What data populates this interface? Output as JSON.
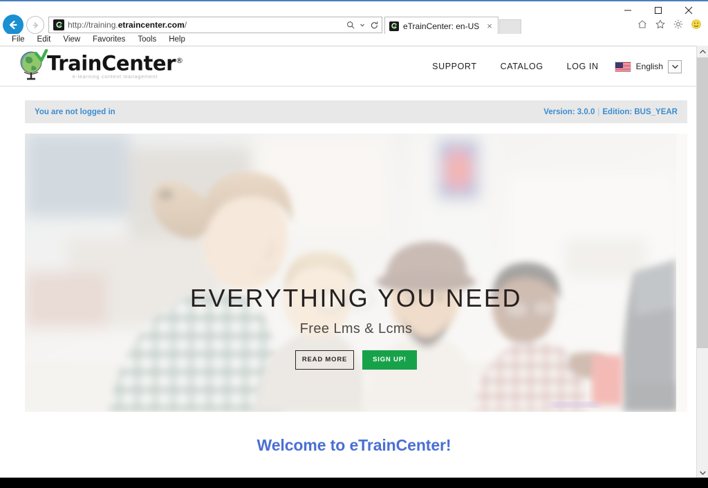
{
  "browser": {
    "window_controls": {
      "minimize": "minimize-icon",
      "maximize": "maximize-icon",
      "close": "close-icon"
    },
    "back_icon": "back-arrow-icon",
    "forward_icon": "forward-arrow-icon",
    "address": {
      "protocol": "http://training.",
      "domain": "etraincenter.com",
      "path": "/",
      "favicon": "etraincenter-favicon",
      "search_icon": "search-icon",
      "dropdown_icon": "chevron-down-icon",
      "refresh_icon": "refresh-icon"
    },
    "tab": {
      "title": "eTrainCenter: en-US",
      "favicon": "etraincenter-favicon",
      "close_label": "×"
    },
    "toolbar_icons": [
      "home-icon",
      "favorites-star-icon",
      "gear-icon",
      "smiley-icon"
    ],
    "menubar": [
      "File",
      "Edit",
      "View",
      "Favorites",
      "Tools",
      "Help"
    ]
  },
  "site": {
    "logo": {
      "text": "TrainCenter",
      "registered_mark": "®",
      "tagline": "e-learning content management"
    },
    "nav": [
      {
        "label": "SUPPORT"
      },
      {
        "label": "CATALOG"
      },
      {
        "label": "LOG IN"
      }
    ],
    "language": {
      "label": "English",
      "flag": "us-flag-icon",
      "dropdown_icon": "chevron-down-icon"
    },
    "status_bar": {
      "login_status": "You are not logged in",
      "version_label": "Version: 3.0.0",
      "separator": "|",
      "edition_label": "Edition: BUS_YEAR"
    },
    "hero": {
      "title": "EVERYTHING YOU NEED",
      "subtitle": "Free Lms & Lcms",
      "primary_button": "READ MORE",
      "secondary_button": "SIGN UP!",
      "image_description": "office-team-at-computers-photo"
    },
    "welcome_heading": "Welcome to eTrainCenter!"
  },
  "colors": {
    "accent_blue": "#3b8dd0",
    "welcome_blue": "#4a6fd4",
    "signup_green": "#17a24a",
    "status_bg": "#e8e8e8",
    "back_button_blue": "#1a8fd1"
  },
  "scrollbar": {
    "up_arrow": "chevron-up-icon",
    "down_arrow": "chevron-down-icon"
  }
}
